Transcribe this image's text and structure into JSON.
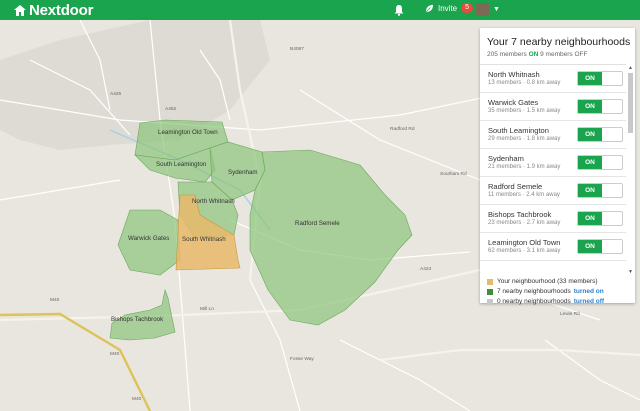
{
  "header": {
    "brand": "Nextdoor",
    "invite_label": "Invite",
    "invite_badge": "5",
    "colors": {
      "header_bg": "#1aa44e"
    }
  },
  "panel": {
    "title": "Your 7 nearby neighbourhoods",
    "members_on": "205 members",
    "on_label": "ON",
    "members_off": "9 members OFF",
    "toggle_label": "ON",
    "neighbourhoods": [
      {
        "name": "North Whitnash",
        "meta": "13 members · 0.8 km away"
      },
      {
        "name": "Warwick Gates",
        "meta": "35 members · 1.5 km away"
      },
      {
        "name": "South Leamington",
        "meta": "29 members · 1.8 km away"
      },
      {
        "name": "Sydenham",
        "meta": "21 members · 1.9 km away"
      },
      {
        "name": "Radford Semele",
        "meta": "11 members · 2.4 km away"
      },
      {
        "name": "Bishops Tachbrook",
        "meta": "23 members · 2.7 km away"
      },
      {
        "name": "Leamington Old Town",
        "meta": "62 members · 3.1 km away"
      }
    ],
    "legend": {
      "yours": "Your neighbourhood (33 members)",
      "on_text": "7 nearby neighbourhoods",
      "on_link": "turned on",
      "off_text": "0 nearby neighbourhoods",
      "off_link": "turned off"
    }
  },
  "map": {
    "areas": {
      "leamington_old_town": "Leamington Old Town",
      "south_leamington": "South Leamington",
      "sydenham": "Sydenham",
      "north_whitnash": "North Whitnash",
      "radford_semele": "Radford Semele",
      "warwick_gates": "Warwick Gates",
      "south_whitnash": "South Whitnash",
      "bishops_tachbrook": "Bishops Tachbrook"
    },
    "roads": {
      "m40_a": "M40",
      "m40_b": "M40",
      "m40_c": "M40",
      "a452": "A452",
      "a425": "A425",
      "a423": "A423",
      "b4087": "B4087",
      "radford_rd": "Radford Rd",
      "southam_rd": "Southam Rd",
      "fosse_way": "Fosse Way",
      "lewis_rd": "Lewis Rd",
      "mill_lane": "Mill Ln"
    },
    "colors": {
      "nearby_fill": "#8cc57a",
      "own_fill": "#e8b96a",
      "background": "#e9e6df"
    }
  }
}
